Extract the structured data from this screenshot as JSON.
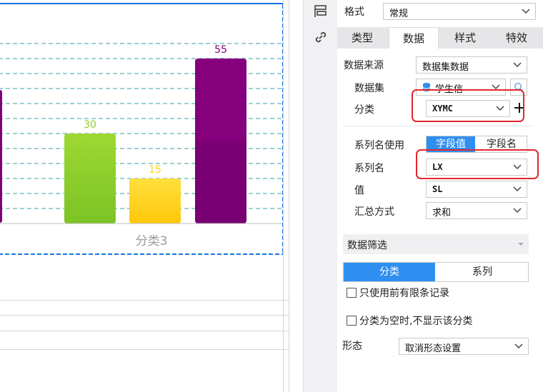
{
  "chart_data": {
    "type": "bar",
    "categories": [
      "分类3"
    ],
    "series": [
      {
        "value": 30,
        "color": "#8fce2a"
      },
      {
        "value": 15,
        "color": "#ffd21f"
      },
      {
        "value": 55,
        "color": "#84007c"
      }
    ],
    "ylim": [
      0,
      60
    ],
    "grid": true
  },
  "toolbar": {
    "format_label": "格式",
    "format_value": "常规"
  },
  "tabs": [
    {
      "label": "类型"
    },
    {
      "label": "数据"
    },
    {
      "label": "样式"
    },
    {
      "label": "特效"
    }
  ],
  "data_source": {
    "label": "数据来源",
    "value": "数据集数据",
    "dataset_label": "数据集",
    "dataset_value": "学生信",
    "category_label": "分类",
    "category_value": "XYMC"
  },
  "series_name": {
    "use_label": "系列名使用",
    "toggle_field_value": "字段值",
    "toggle_field_name": "字段名",
    "label": "系列名",
    "value": "LX",
    "value_label": "值",
    "value_value": "SL",
    "summary_label": "汇总方式",
    "summary_value": "求和"
  },
  "filter": {
    "title": "数据筛选",
    "tab_category": "分类",
    "tab_series": "系列",
    "option_top_records": "只使用前有限条记录",
    "option_hide_empty": "分类为空时,不显示该分类"
  },
  "form_state": {
    "label": "形态",
    "value": "取消形态设置"
  },
  "colors": {
    "accent": "#2f8ff0",
    "highlight": "#e0262f",
    "selection": "#1a73e8",
    "grid": "#3aa3a3"
  }
}
